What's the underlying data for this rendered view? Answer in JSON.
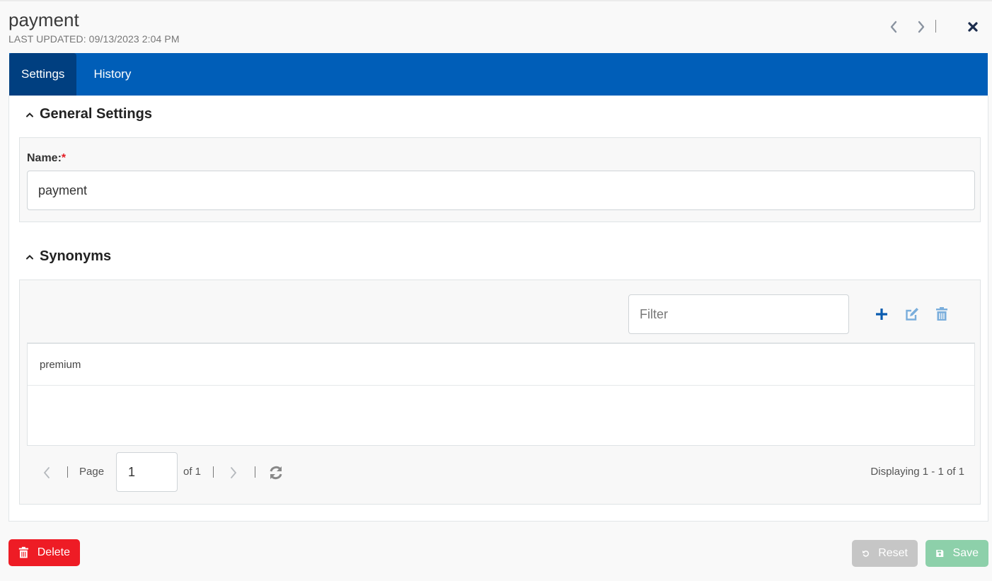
{
  "header": {
    "title": "payment",
    "subtitle": "LAST UPDATED: 09/13/2023 2:04 PM",
    "prev_icon": "chevron-left-icon",
    "next_icon": "chevron-right-icon",
    "close_icon": "close-icon"
  },
  "tabs": [
    {
      "label": "Settings",
      "active": true
    },
    {
      "label": "History",
      "active": false
    }
  ],
  "general_settings": {
    "title": "General Settings",
    "name_label": "Name:",
    "required_marker": "*",
    "name_value": "payment"
  },
  "synonyms": {
    "title": "Synonyms",
    "filter_placeholder": "Filter",
    "toolbar": {
      "add_icon": "plus-icon",
      "edit_icon": "edit-icon",
      "delete_icon": "trash-icon"
    },
    "rows": [
      {
        "value": "premium"
      }
    ],
    "pager": {
      "page_label": "Page",
      "page_value": "1",
      "of_label": "of 1",
      "displaying": "Displaying 1 - 1 of 1"
    }
  },
  "footer": {
    "delete_label": "Delete",
    "reset_label": "Reset",
    "save_label": "Save"
  },
  "colors": {
    "tab_bar": "#005eb8",
    "tab_active": "#003f80",
    "delete": "#ee1c25",
    "reset_disabled": "#c6c6c6",
    "save_disabled": "#8dd0aa",
    "required": "#e31c24"
  }
}
